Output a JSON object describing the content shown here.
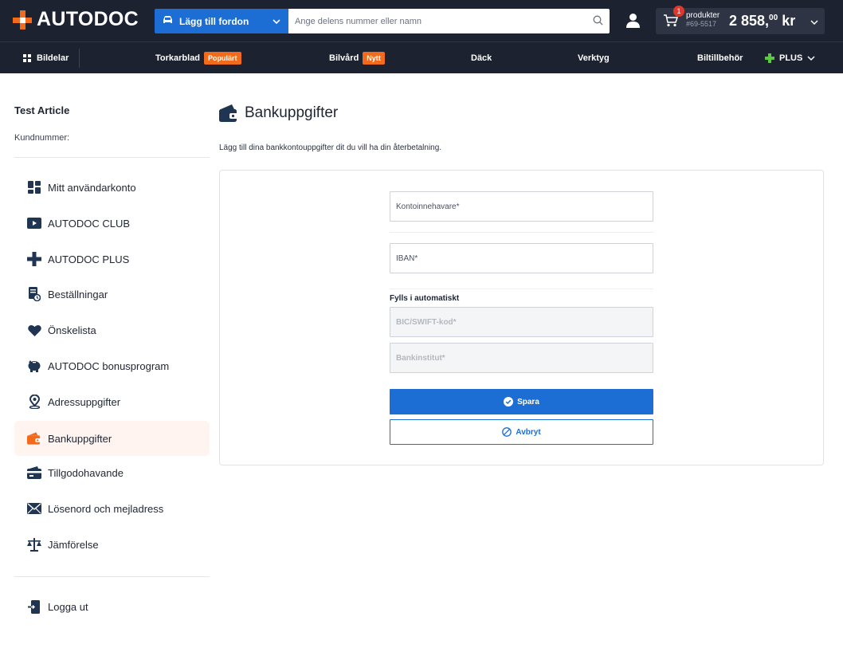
{
  "header": {
    "logo_text": "AUTODOC",
    "vehicle_button": "Lägg till fordon",
    "search_placeholder": "Ange delens nummer eller namn",
    "cart": {
      "count": "1",
      "label": "produkter",
      "number": "#69-5517",
      "price_main": "2 858,",
      "price_decimals": "00",
      "currency": "kr"
    }
  },
  "nav": {
    "items": [
      {
        "label": "Bildelar"
      },
      {
        "label": "Torkarblad",
        "badge": "Populärt"
      },
      {
        "label": "Bilvård",
        "badge": "Nytt"
      },
      {
        "label": "Däck"
      },
      {
        "label": "Verktyg"
      },
      {
        "label": "Biltillbehör"
      },
      {
        "label": "PLUS"
      }
    ]
  },
  "sidebar": {
    "user_name": "Test Article",
    "customer_number_label": "Kundnummer:",
    "items": [
      {
        "label": "Mitt användarkonto",
        "icon": "dashboard-icon"
      },
      {
        "label": "AUTODOC CLUB",
        "icon": "play-icon"
      },
      {
        "label": "AUTODOC PLUS",
        "icon": "plus-icon"
      },
      {
        "label": "Beställningar",
        "icon": "orders-icon"
      },
      {
        "label": "Önskelista",
        "icon": "heart-icon"
      },
      {
        "label": "AUTODOC bonusprogram",
        "icon": "piggy-bank-icon"
      },
      {
        "label": "Adressuppgifter",
        "icon": "location-pin-icon"
      },
      {
        "label": "Bankuppgifter",
        "icon": "wallet-icon",
        "active": true
      },
      {
        "label": "Tillgodohavande",
        "icon": "credit-card-icon"
      },
      {
        "label": "Lösenord och mejladress",
        "icon": "envelope-icon"
      },
      {
        "label": "Jämförelse",
        "icon": "scales-icon"
      }
    ],
    "logout_label": "Logga ut"
  },
  "main": {
    "title": "Bankuppgifter",
    "description": "Lägg till dina bankkontouppgifter dit du vill ha din återbetalning.",
    "form": {
      "holder_placeholder": "Kontoinnehavare*",
      "iban_placeholder": "IBAN*",
      "auto_label": "Fylls i automatiskt",
      "bic_placeholder": "BIC/SWIFT-kod*",
      "bank_placeholder": "Bankinstitut*",
      "save_label": "Spara",
      "cancel_label": "Avbryt"
    }
  },
  "colors": {
    "header_bg": "#1c2230",
    "accent_orange": "#f26b1d",
    "primary_blue": "#1c6ed4",
    "active_item_bg": "#fff4ef"
  }
}
